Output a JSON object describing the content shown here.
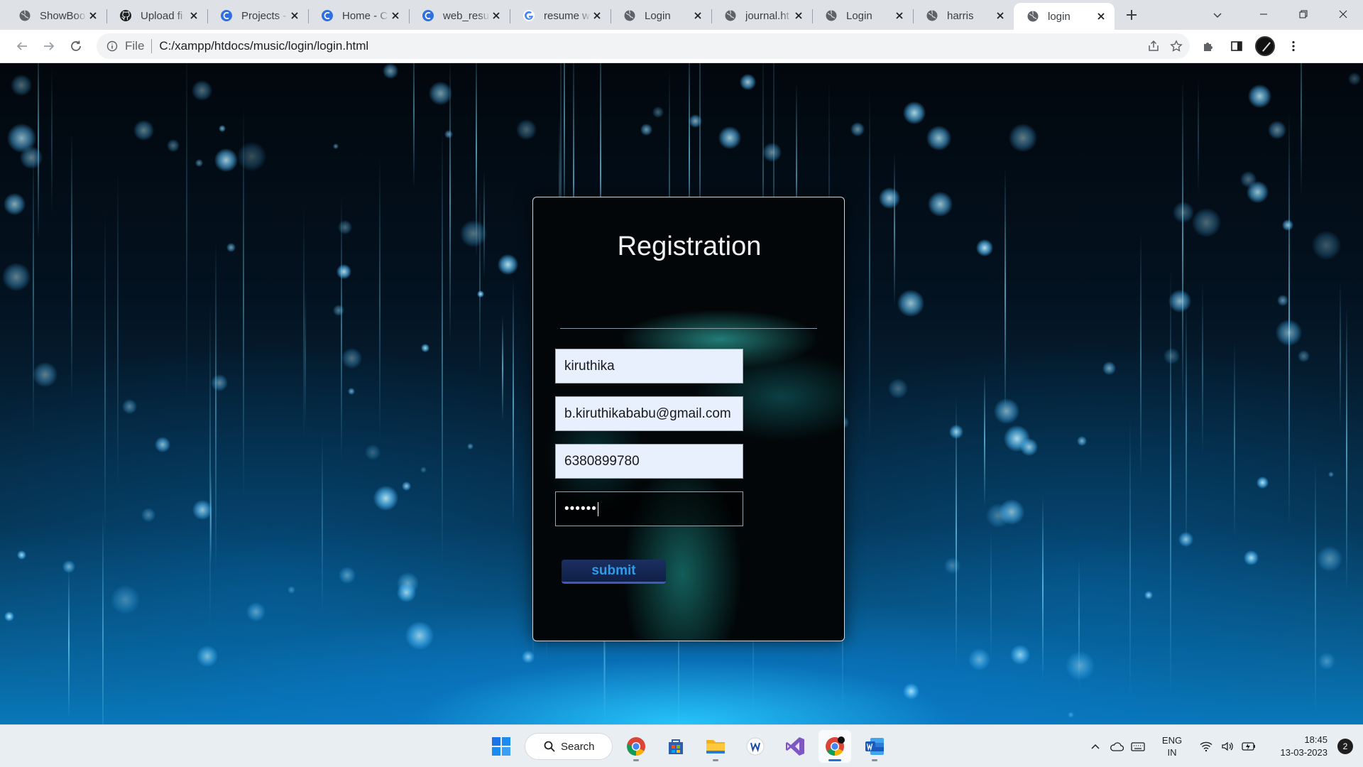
{
  "browser": {
    "tabs": [
      {
        "label": "ShowBoo",
        "icon": "globe-icon"
      },
      {
        "label": "Upload fi",
        "icon": "github-icon"
      },
      {
        "label": "Projects -",
        "icon": "replit-icon"
      },
      {
        "label": "Home - C",
        "icon": "replit-icon"
      },
      {
        "label": "web_resu",
        "icon": "replit-icon"
      },
      {
        "label": "resume w",
        "icon": "google-icon"
      },
      {
        "label": "Login",
        "icon": "globe-icon"
      },
      {
        "label": "journal.ht",
        "icon": "globe-icon"
      },
      {
        "label": "Login",
        "icon": "globe-icon"
      },
      {
        "label": "harris",
        "icon": "globe-icon"
      },
      {
        "label": "login",
        "icon": "globe-icon",
        "active": true
      }
    ],
    "address": {
      "scheme_label": "File",
      "url": "C:/xampp/htdocs/music/login/login.html"
    }
  },
  "form": {
    "title": "Registration",
    "name_value": "kiruthika",
    "email_value": "b.kiruthikababu@gmail.com",
    "phone_value": "6380899780",
    "password_mask": "••••••",
    "submit_label": "submit"
  },
  "taskbar": {
    "search_label": "Search",
    "lang_line1": "ENG",
    "lang_line2": "IN",
    "time": "18:45",
    "date": "13-03-2023",
    "notification_count": "2"
  },
  "colors": {
    "accent_blue": "#2e9ce8",
    "tabstrip": "#dee1e6",
    "field_bg": "#e8f0fe"
  }
}
